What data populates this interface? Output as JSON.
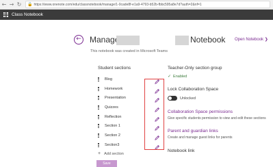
{
  "browser": {
    "back": "←",
    "forward": "→",
    "reload": "↻",
    "lock": "🔒",
    "url": "https://www.onenote.com/edu/classnotebook/manage/1-0cade8f-e1a9-4793-b52b-fbbc595a8e7d?auth=2&nf=1"
  },
  "app": {
    "title": "Class Notebook"
  },
  "header": {
    "back_icon": "←",
    "title_left": "Manage",
    "title_right": "Notebook",
    "open_notebook": "Open Notebook  ❯"
  },
  "note": "This notebook was created in Microsoft Teams",
  "sections": {
    "heading": "Student sections",
    "items": [
      {
        "label": "Blog"
      },
      {
        "label": "Homework"
      },
      {
        "label": "Presentation"
      },
      {
        "label": "Quizzes"
      },
      {
        "label": "Reflection"
      },
      {
        "label": "Section 1"
      },
      {
        "label": "Section 2"
      },
      {
        "label": "Section3"
      }
    ],
    "add_label": "Add section",
    "add_icon": "+",
    "save_label": "Save"
  },
  "right": {
    "teacher_only_heading": "Teacher-Only section group",
    "enabled_icon": "✓",
    "enabled_label": "Enabled",
    "lock_heading": "Lock Collaboration Space",
    "unlocked_label": "Unlocked",
    "collab_heading": "Collaboration Space permissions",
    "collab_desc": "Give specific students permission to view and edit these sections",
    "parent_heading": "Parent and guardian links",
    "parent_desc": "Create and manage guest links for parents",
    "notebook_link_heading": "Notebook link"
  },
  "colors": {
    "accent": "#7a2a90",
    "app_bar": "#3b3b3b",
    "highlight_box": "#e04040",
    "enabled": "#3a7a3a"
  }
}
